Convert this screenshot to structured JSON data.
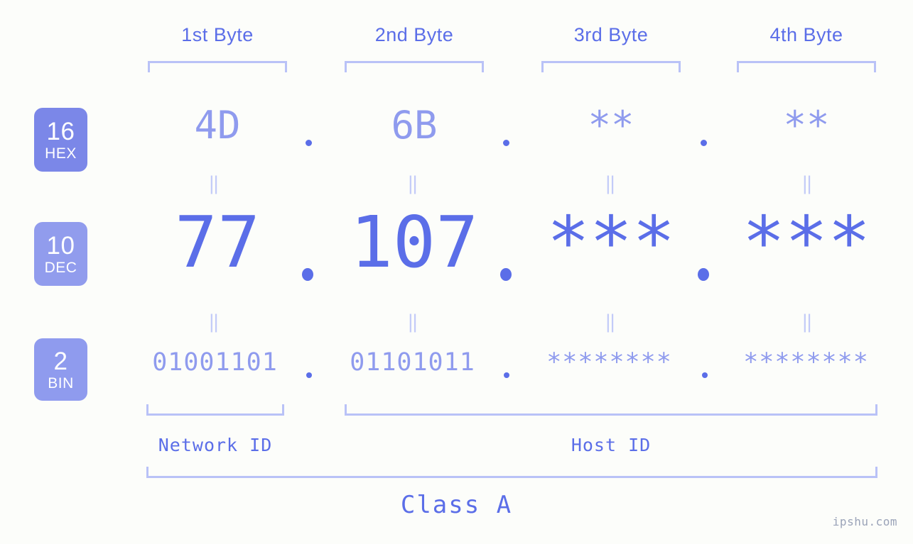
{
  "headers": [
    {
      "label": "1st Byte"
    },
    {
      "label": "2nd Byte"
    },
    {
      "label": "3rd Byte"
    },
    {
      "label": "4th Byte"
    }
  ],
  "rows": {
    "hex": {
      "radix": "16",
      "name": "HEX",
      "badge_color": "#7b87e8",
      "text_color": "#8f9bee",
      "values": [
        "4D",
        "6B",
        "**",
        "**"
      ]
    },
    "dec": {
      "radix": "10",
      "name": "DEC",
      "badge_color": "#919ced",
      "text_color": "#5b6ee8",
      "values": [
        "77",
        "107",
        "***",
        "***"
      ]
    },
    "bin": {
      "radix": "2",
      "name": "BIN",
      "badge_color": "#8f9bee",
      "text_color": "#8f9bee",
      "values": [
        "01001101",
        "01101011",
        "********",
        "********"
      ]
    }
  },
  "separator": ".",
  "equals_glyph": "‖",
  "sections": {
    "network_id": "Network ID",
    "host_id": "Host ID",
    "class": "Class A"
  },
  "watermark": "ipshu.com",
  "colors": {
    "background": "#fcfdfa",
    "accent_strong": "#5b6ee8",
    "accent_light": "#8f9bee",
    "bracket": "#b9c2f7",
    "badge_hex": "#7b87e8",
    "badge_dec": "#919ced",
    "badge_bin": "#8f9bee"
  }
}
